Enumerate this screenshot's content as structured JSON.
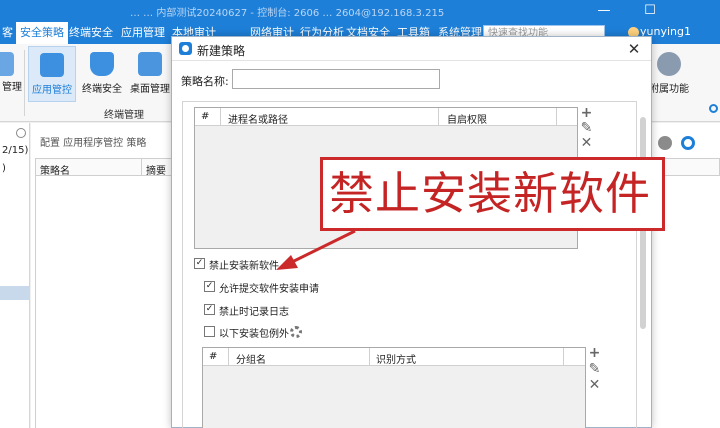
{
  "window": {
    "title": "…  …  内部测试20240627 - 控制台: 2606  …  2604@192.168.3.215",
    "minimize": "—",
    "restore": "☐"
  },
  "menu": {
    "items": [
      {
        "label": "客"
      },
      {
        "label": "安全策略"
      },
      {
        "label": "终端安全"
      },
      {
        "label": "应用管理"
      },
      {
        "label": "本地审计"
      },
      {
        "label": "网络审计"
      },
      {
        "label": "行为分析"
      },
      {
        "label": "文档安全"
      },
      {
        "label": "工具箱"
      },
      {
        "label": "系统管理"
      }
    ],
    "search_placeholder": "快速查找功能",
    "user": "yunying1"
  },
  "ribbon": {
    "buttons": [
      {
        "label": "管理"
      },
      {
        "label": "应用管控"
      },
      {
        "label": "终端安全"
      },
      {
        "label": "桌面管理"
      },
      {
        "label": "附属功能"
      }
    ],
    "group_label": "终端管理"
  },
  "left": {
    "count": "2/15)",
    "paren": ")"
  },
  "main": {
    "breadcrumb": "配置 应用程序管控 策略",
    "col_name": "策略名",
    "col_summary": "摘要"
  },
  "dialog": {
    "title": "新建策略",
    "close": "✕",
    "name_label": "策略名称:",
    "name_value": "",
    "process_table": {
      "col_num": "#",
      "col_path": "进程名或路径",
      "col_autostart": "自启权限"
    },
    "block_install": "禁止安装新软件",
    "allow_request": "允许提交软件安装申请",
    "log_on_block": "禁止时记录日志",
    "except_packages": "以下安装包例外",
    "checkbox_mark": "✓",
    "group_table": {
      "col_num": "#",
      "col_group": "分组名",
      "col_ident": "识别方式"
    },
    "tool_add": "+",
    "tool_edit": "✎",
    "tool_delete": "✕"
  },
  "annotation": {
    "text": "禁止安装新软件",
    "color": "#c52424"
  }
}
